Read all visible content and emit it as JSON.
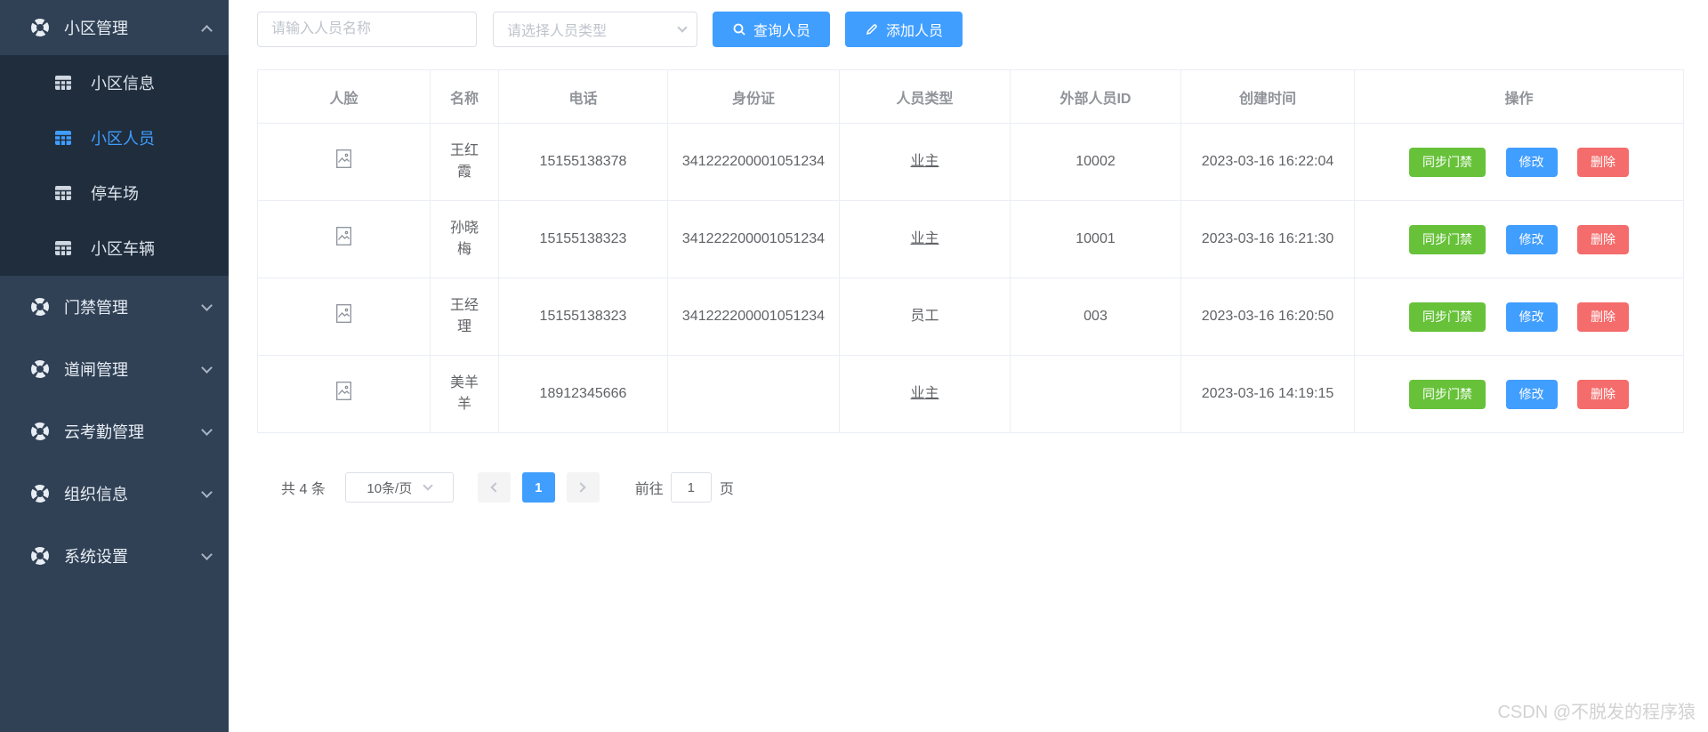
{
  "colors": {
    "primary": "#409EFF",
    "success": "#67C23A",
    "danger": "#F56C6C",
    "sidebar_bg": "#304156",
    "submenu_bg": "#1f2d3d",
    "table_border": "#ebeef5",
    "header_text": "#909399",
    "cell_text": "#606266"
  },
  "icons": {
    "sidebar_group": "compass-icon",
    "submenu_item": "table-grid-icon",
    "search": "search-icon",
    "add": "edit-pencil-icon",
    "face_placeholder": "image-placeholder-icon"
  },
  "sidebar": {
    "groups": [
      {
        "label": "小区管理",
        "state": "expanded",
        "children": [
          {
            "label": "小区信息",
            "active": false
          },
          {
            "label": "小区人员",
            "active": true
          },
          {
            "label": "停车场",
            "active": false
          },
          {
            "label": "小区车辆",
            "active": false
          }
        ]
      },
      {
        "label": "门禁管理",
        "state": "collapsed"
      },
      {
        "label": "道闸管理",
        "state": "collapsed"
      },
      {
        "label": "云考勤管理",
        "state": "collapsed"
      },
      {
        "label": "组织信息",
        "state": "collapsed"
      },
      {
        "label": "系统设置",
        "state": "collapsed"
      }
    ]
  },
  "toolbar": {
    "name_input_placeholder": "请输入人员名称",
    "type_select_placeholder": "请选择人员类型",
    "search_button": "查询人员",
    "add_button": "添加人员"
  },
  "table": {
    "columns": {
      "face": "人脸",
      "name": "名称",
      "phone": "电话",
      "id_card": "身份证",
      "type": "人员类型",
      "external_id": "外部人员ID",
      "created_at": "创建时间",
      "actions": "操作"
    },
    "action_buttons": {
      "sync": "同步门禁",
      "edit": "修改",
      "delete": "删除"
    },
    "rows": [
      {
        "name": "王红霞",
        "phone": "15155138378",
        "id_card": "341222200001051234",
        "type": "业主",
        "external_id": "10002",
        "created_at": "2023-03-16 16:22:04"
      },
      {
        "name": "孙晓梅",
        "phone": "15155138323",
        "id_card": "341222200001051234",
        "type": "业主",
        "external_id": "10001",
        "created_at": "2023-03-16 16:21:30"
      },
      {
        "name": "王经理",
        "phone": "15155138323",
        "id_card": "341222200001051234",
        "type": "员工",
        "external_id": "003",
        "created_at": "2023-03-16 16:20:50"
      },
      {
        "name": "美羊羊",
        "phone": "18912345666",
        "id_card": "",
        "type": "业主",
        "external_id": "",
        "created_at": "2023-03-16 14:19:15"
      }
    ]
  },
  "pagination": {
    "total_label": "共 4 条",
    "page_size": "10条/页",
    "current_page": "1",
    "goto_label": "前往",
    "goto_value": "1",
    "page_unit": "页"
  },
  "watermark": "CSDN @不脱发的程序猿"
}
